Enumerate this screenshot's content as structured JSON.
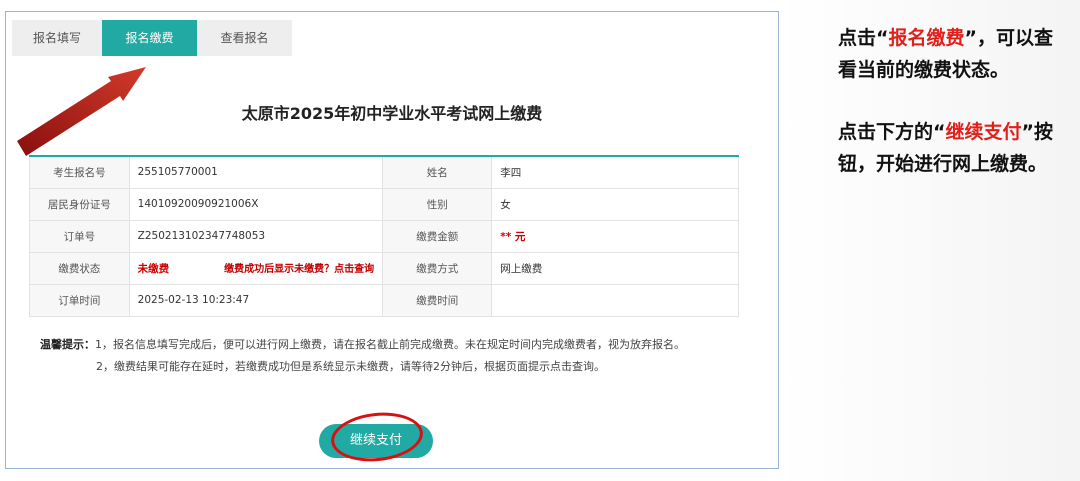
{
  "tabs": [
    {
      "label": "报名填写",
      "active": false
    },
    {
      "label": "报名缴费",
      "active": true
    },
    {
      "label": "查看报名",
      "active": false
    }
  ],
  "page_title": "太原市2025年初中学业水平考试网上缴费",
  "info": {
    "exam_no_label": "考生报名号",
    "exam_no": "255105770001",
    "name_label": "姓名",
    "name": "李四",
    "id_label": "居民身份证号",
    "id_no": "14010920090921006X",
    "gender_label": "性别",
    "gender": "女",
    "order_label": "订单号",
    "order_no": "Z250213102347748053",
    "amount_label": "缴费金额",
    "amount": "** 元",
    "status_label": "缴费状态",
    "status": "未缴费",
    "status_hint": "缴费成功后显示未缴费？点击查询",
    "method_label": "缴费方式",
    "method": "网上缴费",
    "order_time_label": "订单时间",
    "order_time": "2025-02-13 10:23:47",
    "pay_time_label": "缴费时间",
    "pay_time": ""
  },
  "notice": {
    "head": "温馨提示：",
    "line1": "1，报名信息填写完成后，便可以进行网上缴费，请在报名截止前完成缴费。未在规定时间内完成缴费者，视为放弃报名。",
    "line2": "2，缴费结果可能存在延时，若缴费成功但是系统显示未缴费，请等待2分钟后，根据页面提示点击查询。"
  },
  "pay_button_label": "继续支付",
  "instructions": {
    "p1_pre": "点击“",
    "p1_hl": "报名缴费",
    "p1_post": "”，可以查看当前的缴费状态。",
    "p2_pre": "点击下方的“",
    "p2_hl": "继续支付",
    "p2_post": "”按钮，开始进行网上缴费。"
  },
  "colors": {
    "accent": "#21aaa3",
    "highlight_red": "#e0201b",
    "status_red": "#d40000"
  }
}
